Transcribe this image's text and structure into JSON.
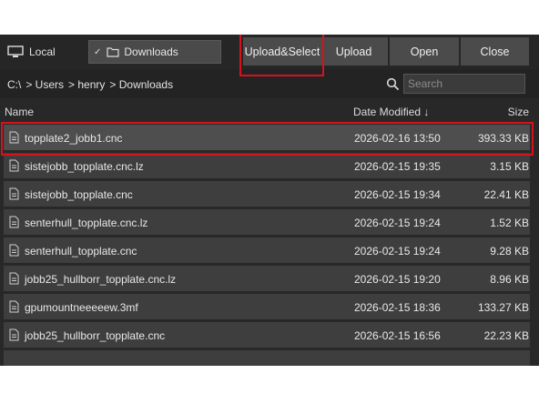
{
  "toolbar": {
    "location_label": "Local",
    "folder_selected": "Downloads",
    "buttons": {
      "upload_select": "Upload&Select",
      "upload": "Upload",
      "open": "Open",
      "close": "Close"
    }
  },
  "pathbar": {
    "crumbs": [
      "C:\\",
      "> Users",
      "> henry",
      "> Downloads"
    ],
    "search_placeholder": "Search"
  },
  "columns": {
    "name": "Name",
    "date": "Date Modified ↓",
    "size": "Size"
  },
  "files": [
    {
      "name": "topplate2_jobb1.cnc",
      "date": "2026-02-16 13:50",
      "size": "393.33 KB",
      "selected": true
    },
    {
      "name": "sistejobb_topplate.cnc.lz",
      "date": "2026-02-15 19:35",
      "size": "3.15 KB"
    },
    {
      "name": "sistejobb_topplate.cnc",
      "date": "2026-02-15 19:34",
      "size": "22.41 KB"
    },
    {
      "name": "senterhull_topplate.cnc.lz",
      "date": "2026-02-15 19:24",
      "size": "1.52 KB"
    },
    {
      "name": "senterhull_topplate.cnc",
      "date": "2026-02-15 19:24",
      "size": "9.28 KB"
    },
    {
      "name": "jobb25_hullborr_topplate.cnc.lz",
      "date": "2026-02-15 19:20",
      "size": "8.96 KB"
    },
    {
      "name": "gpumountneeeeew.3mf",
      "date": "2026-02-15 18:36",
      "size": "133.27 KB"
    },
    {
      "name": "jobb25_hullborr_topplate.cnc",
      "date": "2026-02-15 16:56",
      "size": "22.23 KB"
    }
  ],
  "colors": {
    "highlight": "#d8121c",
    "row_bg": "#3e3e3e",
    "row_selected_bg": "#4e4e4e",
    "panel_bg": "#282828",
    "button_bg": "#4b4b4b"
  }
}
